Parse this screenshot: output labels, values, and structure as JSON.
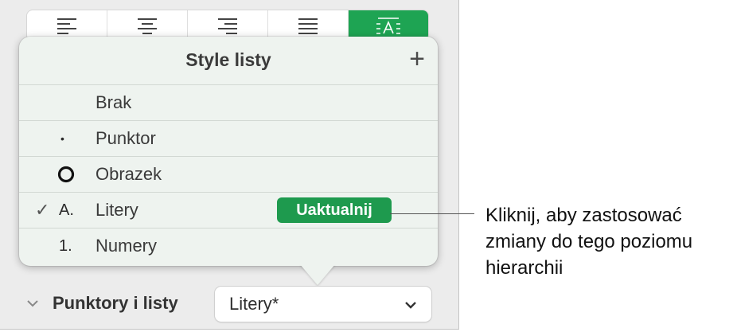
{
  "alignment_bar": {
    "buttons": [
      {
        "name": "align-left-icon",
        "selected": false
      },
      {
        "name": "align-center-icon",
        "selected": false
      },
      {
        "name": "align-right-icon",
        "selected": false
      },
      {
        "name": "justify-icon",
        "selected": false
      },
      {
        "name": "text-columns-icon",
        "selected": true
      }
    ],
    "accent_color": "#1ea453"
  },
  "popover": {
    "title": "Style listy",
    "add_symbol": "+",
    "items": [
      {
        "glyph": "",
        "label": "Brak"
      },
      {
        "glyph": "•",
        "label": "Punktor"
      },
      {
        "glyph": "○",
        "label": "Obrazek"
      },
      {
        "glyph": "A.",
        "label": "Litery",
        "checked": true,
        "check_symbol": "✓",
        "action_label": "Uaktualnij"
      },
      {
        "glyph": "1.",
        "label": "Numery"
      }
    ]
  },
  "footer": {
    "section_label": "Punktory i listy",
    "select_value": "Litery*"
  },
  "callout": {
    "text": "Kliknij, aby zastosować zmiany do tego poziomu hierarchii"
  }
}
